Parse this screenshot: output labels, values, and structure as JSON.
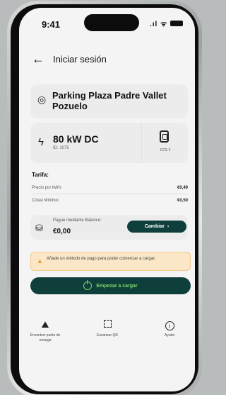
{
  "status_bar": {
    "time": "9:41",
    "signal": ".ıl ᯤ"
  },
  "header": {
    "back_icon": "arrow-left-icon",
    "title": "Iniciar sesión"
  },
  "location": {
    "icon": "location-pin-icon",
    "name": "Parking Plaza Padre Vallet Pozuelo"
  },
  "charger": {
    "icon": "bolt-icon",
    "power": "80 kW DC",
    "id": "ID: 1075",
    "connector_icon": "plug-icon",
    "connector": "CCS 2"
  },
  "tarifa": {
    "title": "Tarifa:",
    "rows": [
      {
        "label": "Precio por kWh:",
        "value": "€0,49"
      },
      {
        "label": "Coste Mínimo:",
        "value": "€0,50"
      }
    ]
  },
  "balance": {
    "icon": "coins-icon",
    "label": "Pague mediante Balance:",
    "amount": "€0,00",
    "button_label": "Cambiar",
    "button_icon": "chevron-right-icon"
  },
  "alert": {
    "icon": "warning-icon",
    "text": "Añade un método de pago para poder comenzar a cargar."
  },
  "start_button": {
    "icon": "power-icon",
    "label": "Empezar a cargar"
  },
  "bottom_nav": [
    {
      "icon": "map-icon",
      "label": "Encontrar punto de recarga"
    },
    {
      "icon": "qr-code-icon",
      "label": "Escanear QR"
    },
    {
      "icon": "info-icon",
      "label": "Ayuda"
    }
  ],
  "colors": {
    "accent": "#0e3f3b",
    "start_text": "#7bd86a",
    "alert_bg": "#fbe7c8",
    "warning": "#e49c2c"
  }
}
